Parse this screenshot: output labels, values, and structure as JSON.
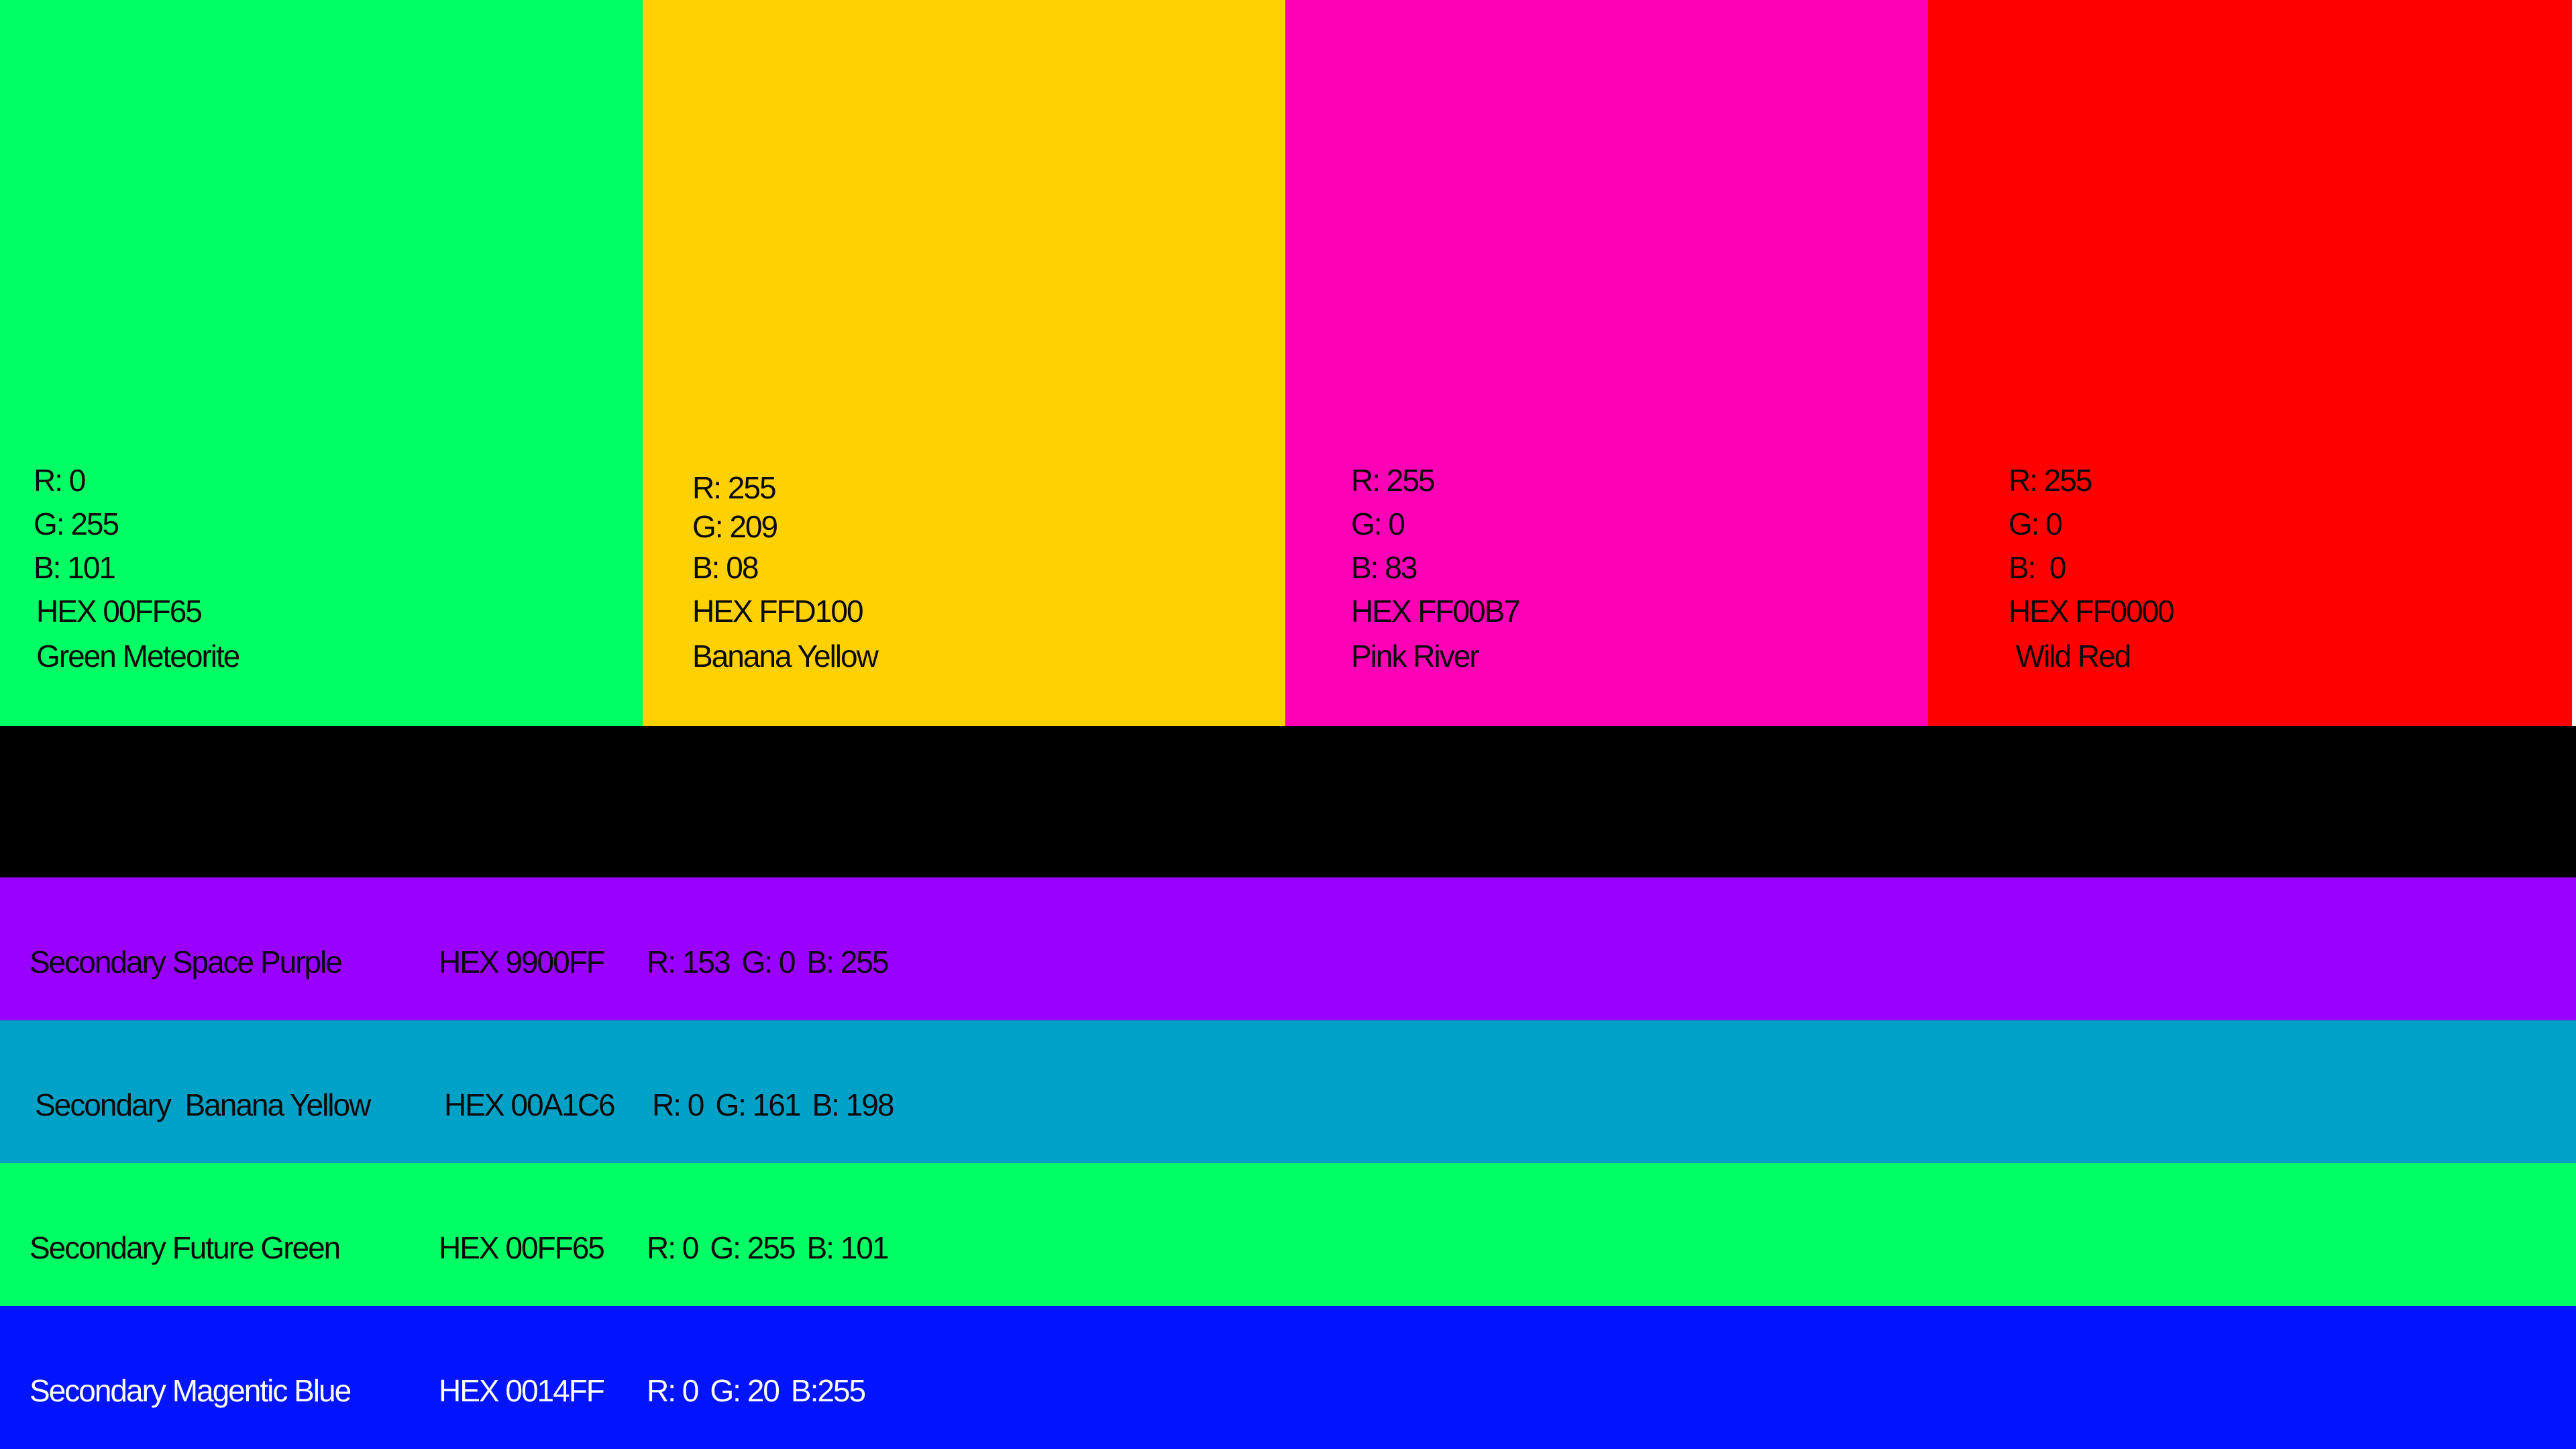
{
  "primary": [
    {
      "r": "R: 0",
      "g": "G: 255",
      "b": "B: 101",
      "hex": "HEX 00FF65",
      "name": "Green Meteorite",
      "color": "#00FF65"
    },
    {
      "r": "R: 255",
      "g": "G: 209",
      "b": "B: 08",
      "hex": "HEX FFD100",
      "name": "Banana Yellow",
      "color": "#FFD100"
    },
    {
      "r": "R: 255",
      "g": "G: 0",
      "b": "B: 83",
      "hex": "HEX FF00B7",
      "name": "Pink River",
      "color": "#FF00B7"
    },
    {
      "r": "R: 255",
      "g": "G: 0",
      "b": "B:  0",
      "hex": "HEX FF0000",
      "name": " Wild Red",
      "color": "#FF0000"
    }
  ],
  "secondary": [
    {
      "label": "Secondary Space Purple",
      "hex": "HEX 9900FF",
      "r": "R: 153",
      "g": "G: 0",
      "b": "B: 255",
      "color": "#9900FF",
      "text_color": "#0a0a0a"
    },
    {
      "label": "Secondary  Banana Yellow",
      "hex": "HEX 00A1C6",
      "r": "R: 0",
      "g": "G: 161",
      "b": "B: 198",
      "color": "#00A1C6",
      "text_color": "#0a0a0a"
    },
    {
      "label": "Secondary Future Green",
      "hex": "HEX 00FF65",
      "r": "R: 0",
      "g": "G: 255",
      "b": "B: 101",
      "color": "#00FF65",
      "text_color": "#0a0a0a"
    },
    {
      "label": "Secondary Magentic Blue",
      "hex": "HEX 0014FF",
      "r": "R: 0",
      "g": "G: 20",
      "b": "B:255",
      "color": "#0014FF",
      "text_color": "#ffffff"
    }
  ]
}
